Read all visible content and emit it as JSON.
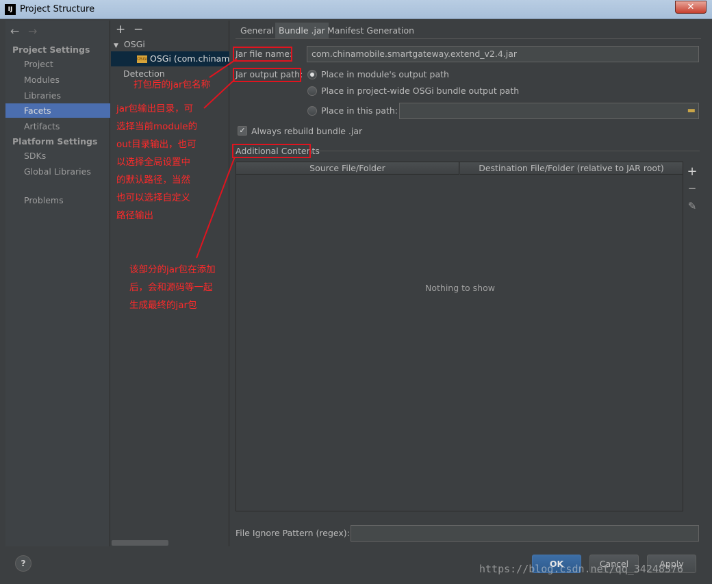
{
  "window": {
    "title": "Project Structure",
    "close_label": "✕"
  },
  "nav": {
    "back_icon": "←",
    "forward_icon": "→",
    "project_settings": "Project Settings",
    "project_items": [
      "Project",
      "Modules",
      "Libraries",
      "Facets",
      "Artifacts"
    ],
    "platform_settings": "Platform Settings",
    "platform_items": [
      "SDKs",
      "Global Libraries"
    ],
    "problems": "Problems",
    "selected": "Facets"
  },
  "tree": {
    "add_icon": "+",
    "remove_icon": "−",
    "root": "OSGi",
    "badge": "OSGi",
    "child": "OSGi (com.chinamobile",
    "detection": "Detection"
  },
  "tabs": [
    "General",
    "Bundle .jar",
    "Manifest Generation"
  ],
  "form": {
    "jar_file_label": "Jar file name:",
    "jar_file_value": "com.chinamobile.smartgateway.extend_v2.4.jar",
    "output_label": "Jar output path:",
    "radio_module": "Place in module's output path",
    "radio_project": "Place in project-wide OSGi bundle output path",
    "radio_path": "Place in this path:",
    "always_rebuild": "Always rebuild bundle .jar",
    "additional_contents": "Additional Contents",
    "col_source": "Source File/Folder",
    "col_dest": "Destination File/Folder (relative to JAR root)",
    "empty": "Nothing to show",
    "ignore_label": "File Ignore Pattern (regex):"
  },
  "buttons": {
    "help": "?",
    "ok": "OK",
    "cancel": "Cancel",
    "apply": "Apply"
  },
  "annotations": {
    "a1": "打包后的jar包名称",
    "a2": [
      "jar包输出目录，可",
      "选择当前module的",
      "out目录输出，也可",
      "以选择全局设置中",
      "的默认路径，当然",
      "也可以选择自定义",
      "路径输出"
    ],
    "a3": [
      "该部分的jar包在添加",
      "后，会和源码等一起",
      "生成最终的jar包"
    ]
  },
  "watermark": "https://blog.csdn.net/qq_34248376",
  "colors": {
    "accent": "#4b6eaf",
    "annotation": "#e0141f",
    "background": "#3c3f41"
  }
}
